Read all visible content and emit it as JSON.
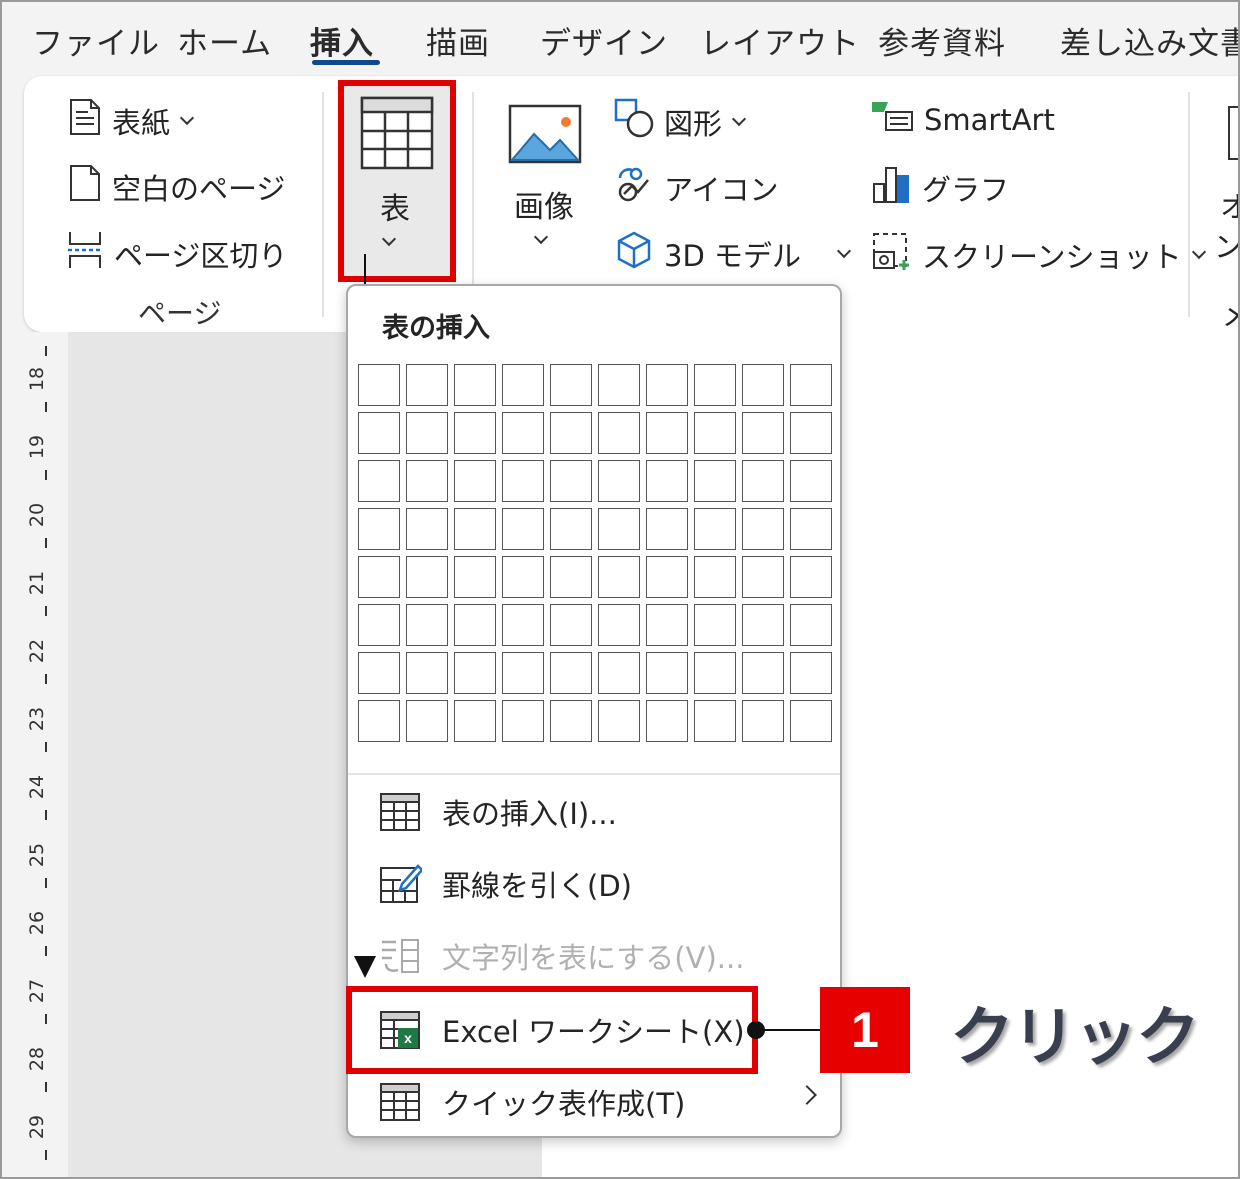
{
  "tabs": [
    "ファイル",
    "ホーム",
    "挿入",
    "描画",
    "デザイン",
    "レイアウト",
    "参考資料",
    "差し込み文書"
  ],
  "ribbon": {
    "pages_group": {
      "cover": "表紙",
      "blank_page": "空白のページ",
      "page_break": "ページ区切り",
      "label": "ページ"
    },
    "table_button": "表",
    "image_button": "画像",
    "shapes": "図形",
    "icons": "アイコン",
    "model3d": "3D モデル",
    "smartart": "SmartArt",
    "chart": "グラフ",
    "screenshot": "スクリーンショット",
    "cutoff_top": "オ",
    "cutoff_mid": "ン",
    "cutoff_bottom": "メ"
  },
  "ruler": [
    "18",
    "19",
    "20",
    "21",
    "22",
    "23",
    "24",
    "25",
    "26",
    "27",
    "28",
    "29"
  ],
  "dropdown": {
    "title": "表の挿入",
    "grid_cols": 10,
    "grid_rows": 8,
    "items": [
      {
        "label": "表の挿入(I)...",
        "enabled": true
      },
      {
        "label": "罫線を引く(D)",
        "enabled": true
      },
      {
        "label": "文字列を表にする(V)...",
        "enabled": false
      },
      {
        "label": "Excel ワークシート(X)",
        "enabled": true
      },
      {
        "label": "クイック表作成(T)",
        "enabled": true
      }
    ]
  },
  "annotation": {
    "step": "1",
    "action": "クリック"
  },
  "colors": {
    "highlight": "#e00000",
    "tab_underline": "#0f4a8c",
    "excel_green": "#1e7a45"
  }
}
